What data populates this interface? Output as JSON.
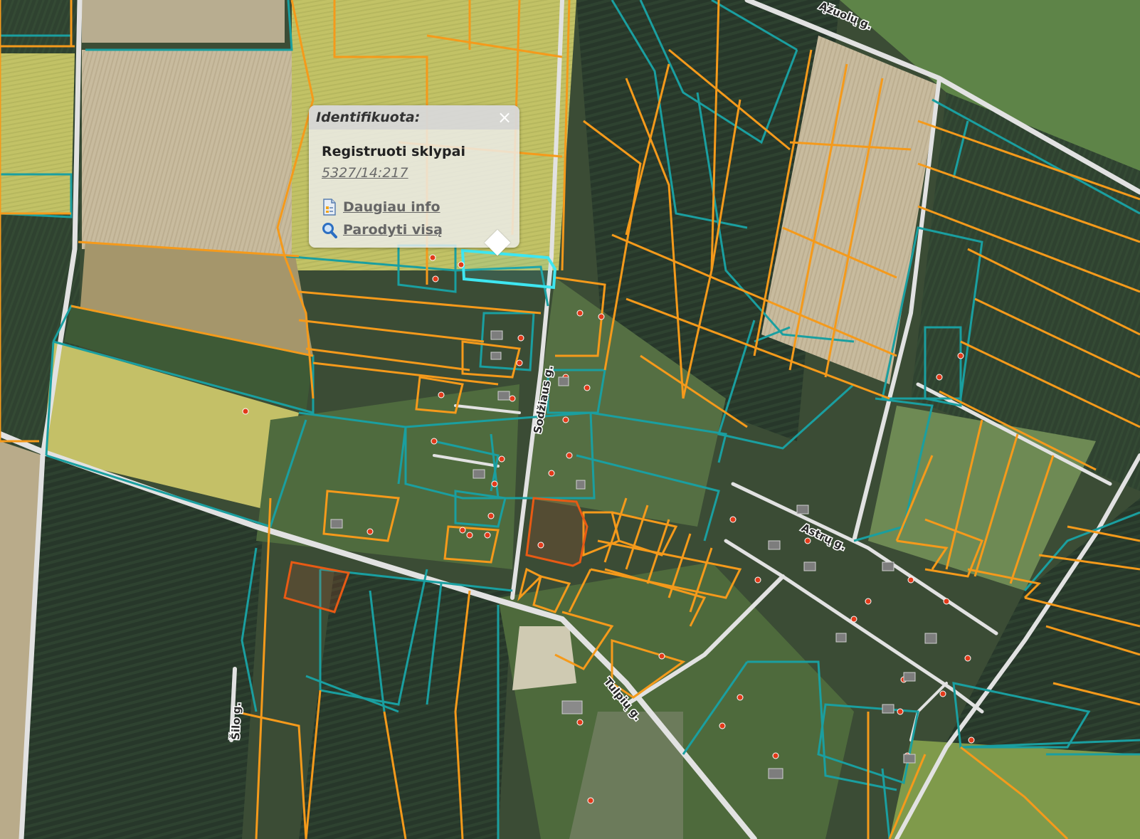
{
  "map": {
    "colors": {
      "parcel_orange": "#f59a1b",
      "parcel_teal": "#1a9fa0",
      "road": "#e6e6e6",
      "selected": "#3ee6f0",
      "field_dark": "#2f3f2c",
      "field_yellow": "#c9c86b",
      "field_bare": "#cdbfa2",
      "field_green": "#5c7a45",
      "marker": "#e23a1a"
    },
    "road_labels": [
      {
        "text": "Sodžiaus g.",
        "id": "road-label-1"
      },
      {
        "text": "Astrų g.",
        "id": "road-label-2"
      },
      {
        "text": "Tulpių g.",
        "id": "road-label-3"
      },
      {
        "text": "Ąžuolų g.",
        "id": "road-label-4"
      },
      {
        "text": "Šilo g.",
        "id": "road-label-5"
      }
    ]
  },
  "popup": {
    "title": "Identifikuota:",
    "close_label": "×",
    "layer_name": "Registruoti sklypai",
    "parcel_number": "5327/14:217",
    "more_info_label": "Daugiau info",
    "show_all_label": "Parodyti visą",
    "icons": [
      "document-icon",
      "magnifier-icon"
    ]
  }
}
